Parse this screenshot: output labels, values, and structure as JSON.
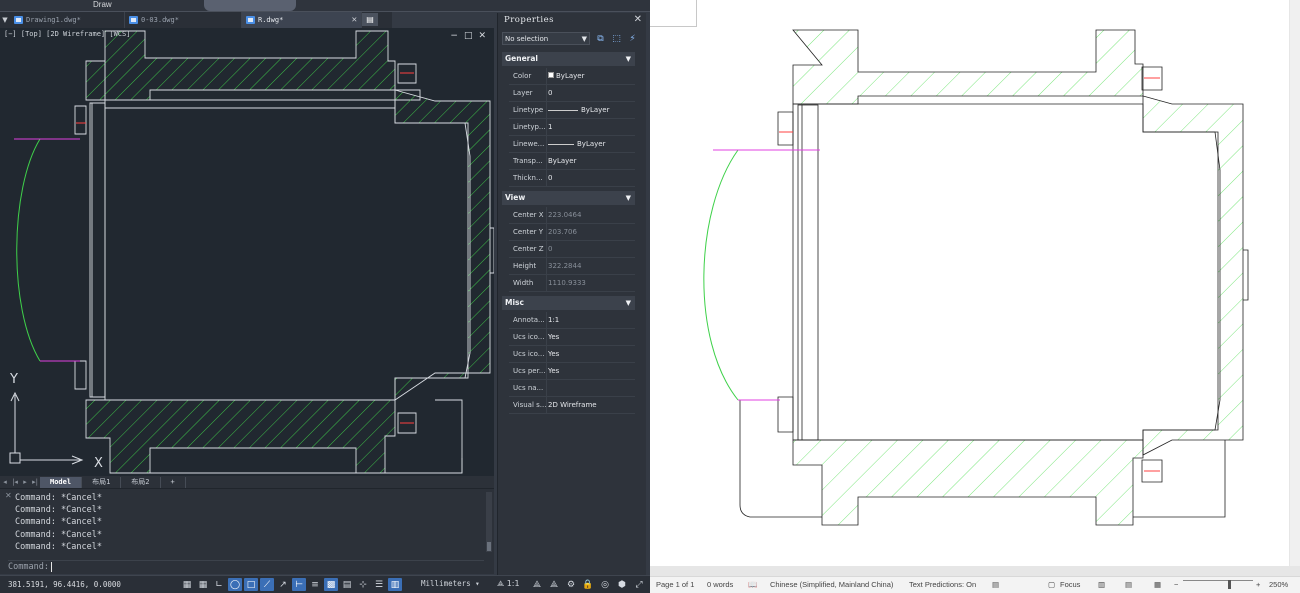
{
  "cad": {
    "ribbon": {
      "visible_label": "Draw"
    },
    "document_tabs": [
      {
        "label": "Drawing1.dwg*",
        "active": false
      },
      {
        "label": "0-03.dwg*",
        "active": false
      },
      {
        "label": "R.dwg*",
        "active": true
      }
    ],
    "viewport_label": "[−] [Top] [2D Wireframe] [WCS]",
    "viewport_controls": {
      "minimize": "−",
      "restore": "□",
      "close": "✕"
    },
    "ucs": {
      "y_label": "Y",
      "x_label": "X"
    },
    "layout_tabs": [
      {
        "label": "Model",
        "active": true
      },
      {
        "label": "布局1",
        "active": false
      },
      {
        "label": "布局2",
        "active": false
      },
      {
        "label": "+",
        "active": false
      }
    ],
    "command_history": [
      "Command: *Cancel*",
      "Command: *Cancel*",
      "Command: *Cancel*",
      "Command: *Cancel*",
      "Command: *Cancel*"
    ],
    "command_prompt": "Command:",
    "status": {
      "coordinates": "381.5191, 96.4416, 0.0000",
      "units": "Millimeters",
      "scale": "1:1"
    },
    "properties": {
      "title": "Properties",
      "selection": "No selection",
      "sections": [
        {
          "name": "General",
          "rows": [
            {
              "key": "Color",
              "value": "ByLayer"
            },
            {
              "key": "Layer",
              "value": "0"
            },
            {
              "key": "Linetype",
              "value": "ByLayer"
            },
            {
              "key": "Linetyp...",
              "value": "1"
            },
            {
              "key": "Linewe...",
              "value": "ByLayer"
            },
            {
              "key": "Transp...",
              "value": "ByLayer"
            },
            {
              "key": "Thickn...",
              "value": "0"
            }
          ]
        },
        {
          "name": "View",
          "rows": [
            {
              "key": "Center X",
              "value": "223.0464"
            },
            {
              "key": "Center Y",
              "value": "203.706"
            },
            {
              "key": "Center Z",
              "value": "0"
            },
            {
              "key": "Height",
              "value": "322.2844"
            },
            {
              "key": "Width",
              "value": "1110.9333"
            }
          ]
        },
        {
          "name": "Misc",
          "rows": [
            {
              "key": "Annota...",
              "value": "1:1"
            },
            {
              "key": "Ucs ico...",
              "value": "Yes"
            },
            {
              "key": "Ucs ico...",
              "value": "Yes"
            },
            {
              "key": "Ucs per...",
              "value": "Yes"
            },
            {
              "key": "Ucs na...",
              "value": ""
            },
            {
              "key": "Visual s...",
              "value": "2D Wireframe"
            }
          ]
        }
      ]
    }
  },
  "word": {
    "status": {
      "page": "Page 1 of 1",
      "words": "0 words",
      "language": "Chinese (Simplified, Mainland China)",
      "text_predictions": "Text Predictions: On",
      "focus": "Focus",
      "zoom": "250%"
    }
  },
  "colors": {
    "hatch": "#3fd14a",
    "cad_background": "#212830",
    "magenta": "#e040e0",
    "accent": "#3b6fb6"
  }
}
